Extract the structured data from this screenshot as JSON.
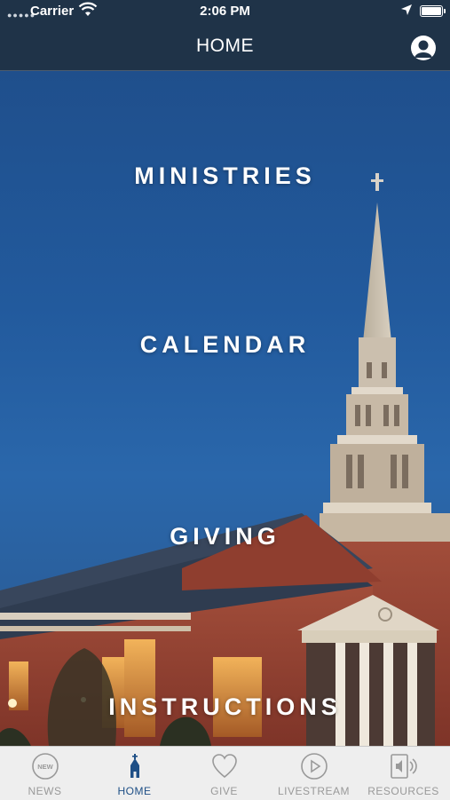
{
  "status_bar": {
    "carrier": "Carrier",
    "time": "2:06 PM",
    "battery_level": 0.9
  },
  "nav": {
    "title": "HOME"
  },
  "menu": [
    {
      "label": "MINISTRIES"
    },
    {
      "label": "CALENDAR"
    },
    {
      "label": "GIVING"
    },
    {
      "label": "INSTRUCTIONS"
    }
  ],
  "tabs": [
    {
      "label": "NEWS",
      "icon_text": "NEW",
      "icon": "news-icon",
      "active": false
    },
    {
      "label": "HOME",
      "icon": "church-icon",
      "active": true
    },
    {
      "label": "GIVE",
      "icon": "heart-icon",
      "active": false
    },
    {
      "label": "LIVESTREAM",
      "icon": "play-icon",
      "active": false
    },
    {
      "label": "RESOURCES",
      "icon": "speaker-book-icon",
      "active": false
    }
  ],
  "colors": {
    "bar": "#1f3348",
    "active_tab": "#1e4f86",
    "inactive_tab": "#999999",
    "tab_bar_bg": "#eeeeee"
  }
}
